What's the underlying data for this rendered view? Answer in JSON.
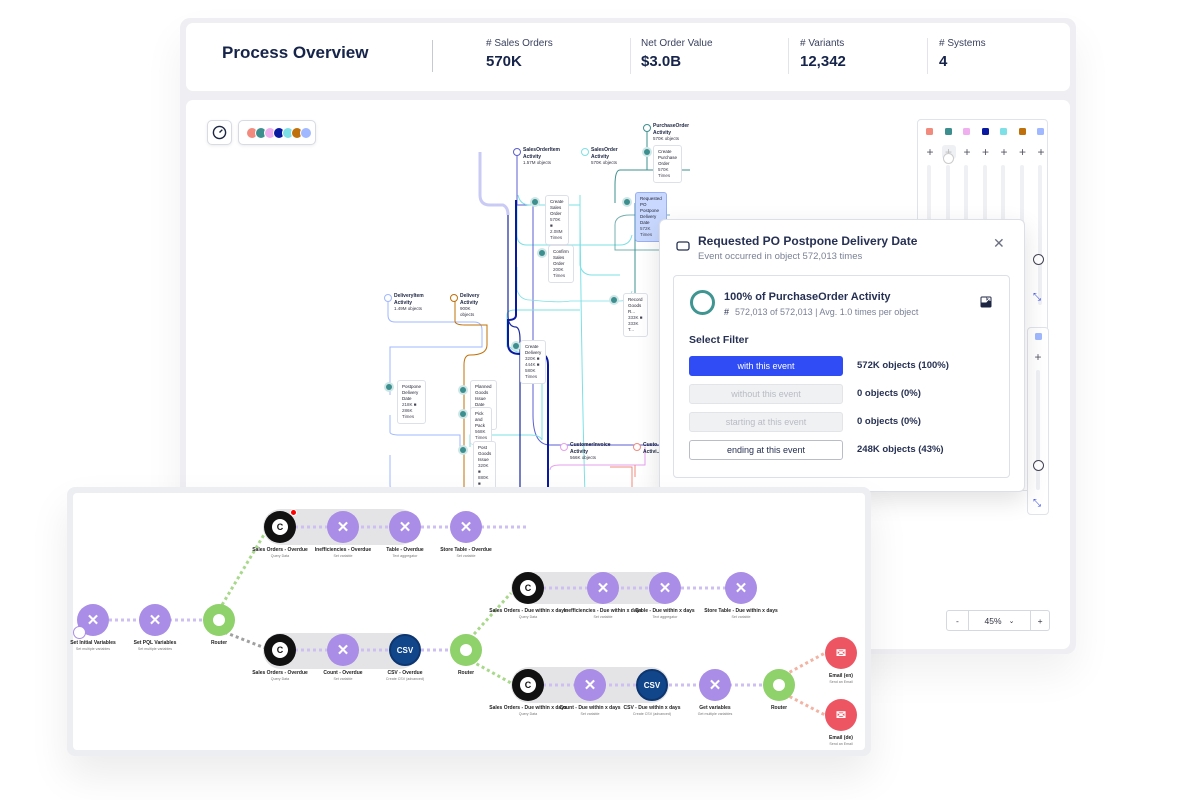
{
  "header": {
    "title": "Process Overview",
    "kpis": [
      {
        "label": "# Sales Orders",
        "value": "570K"
      },
      {
        "label": "Net Order Value",
        "value": "$3.0B"
      },
      {
        "label": "# Variants",
        "value": "12,342"
      },
      {
        "label": "# Systems",
        "value": "4"
      }
    ]
  },
  "toolbar": {
    "gauge_icon": "speedometer-icon",
    "object_colors": [
      "#f28b7d",
      "#3d8f8f",
      "#f0b0f0",
      "#0a1aa0",
      "#7de0e6",
      "#c0700a",
      "#a0b8ff"
    ]
  },
  "map": {
    "objects": [
      {
        "label": "SalesOrderItem Activity",
        "sub": "1.57M objects",
        "color": "#5b5fd0"
      },
      {
        "label": "SalesOrder Activity",
        "sub": "570K objects",
        "color": "#7de0e6"
      },
      {
        "label": "PurchaseOrder Activity",
        "sub": "570K objects",
        "color": "#3d8f8f"
      },
      {
        "label": "DeliveryItem Activity",
        "sub": "1.49M objects",
        "color": "#a0b8ff"
      },
      {
        "label": "Delivery Activity",
        "sub": "900K objects",
        "color": "#c0700a"
      },
      {
        "label": "CustomerInvoice Activity",
        "sub": "566K objects",
        "color": "#e6a0ee"
      },
      {
        "label": "Custo... Activi...",
        "sub": "",
        "color": "#f28b7d"
      }
    ],
    "events": [
      {
        "label": "Create Purchase Order",
        "sub": "570K Times"
      },
      {
        "label": "Create Sales Order",
        "sub": "570K  ■ 2.08M Times"
      },
      {
        "label": "Requested PO Postpone Delivery Date",
        "sub": "572K Times",
        "highlighted": true
      },
      {
        "label": "Confirm Sales Order",
        "sub": "200K Times"
      },
      {
        "label": "Record Goods R...",
        "sub": "333K  ■ 333K T..."
      },
      {
        "label": "Create Delivery",
        "sub": "320K  ■ 444K  ■ 580K Times"
      },
      {
        "label": "Postpone Delivery Date",
        "sub": "218K  ■ 286K Times"
      },
      {
        "label": "Planned Goods Issue Date Passed",
        "sub": "568K Times"
      },
      {
        "label": "Pick and Pack",
        "sub": "568K Times"
      },
      {
        "label": "Post Goods Issue",
        "sub": "320K  ■ 880K  ■ 568K Times"
      }
    ]
  },
  "side_panel": {
    "colors": [
      "#f28b7d",
      "#3d8f8f",
      "#f0b0f0",
      "#0a1aa0",
      "#7de0e6",
      "#c0700a",
      "#a0b8ff"
    ],
    "second_color": "#a0b8ff"
  },
  "popup": {
    "title": "Requested PO Postpone Delivery Date",
    "subtitle": "Event occurred in object 572,013 times",
    "card_title": "100% of PurchaseOrder Activity",
    "card_sub": "572,013 of 572,013 | Avg. 1.0 times per object",
    "coverage_percent": 100,
    "filter_heading": "Select Filter",
    "filters": [
      {
        "label": "with this event",
        "result": "572K objects (100%)",
        "state": "active"
      },
      {
        "label": "without this event",
        "result": "0 objects (0%)",
        "state": "disabled"
      },
      {
        "label": "starting at this event",
        "result": "0 objects (0%)",
        "state": "disabled"
      },
      {
        "label": "ending at this event",
        "result": "248K objects (43%)",
        "state": "default"
      }
    ]
  },
  "zoom": {
    "minus": "-",
    "value": "45%",
    "plus": "+"
  },
  "workflow": {
    "nodes": [
      {
        "type": "tool",
        "label": "Set Initial Variables",
        "sub": "Set multiple variables"
      },
      {
        "type": "tool",
        "label": "Set PQL Variables",
        "sub": "Set multiple variables"
      },
      {
        "type": "router",
        "label": "Router",
        "sub": ""
      },
      {
        "type": "celonis",
        "label": "Sales Orders - Overdue",
        "sub": "Query Data",
        "alert": true
      },
      {
        "type": "tool",
        "label": "Inefficiencies - Overdue",
        "sub": "Set variable"
      },
      {
        "type": "tool",
        "label": "Table - Overdue",
        "sub": "Text aggregator"
      },
      {
        "type": "tool",
        "label": "Store Table - Overdue",
        "sub": "Set variable"
      },
      {
        "type": "celonis",
        "label": "Sales Orders - Overdue",
        "sub": "Query Data"
      },
      {
        "type": "tool",
        "label": "Count - Overdue",
        "sub": "Set variable"
      },
      {
        "type": "csv",
        "label": "CSV - Overdue",
        "sub": "Create CSV (advanced)"
      },
      {
        "type": "router",
        "label": "Router",
        "sub": ""
      },
      {
        "type": "celonis",
        "label": "Sales Orders - Due within x days",
        "sub": "Query Data"
      },
      {
        "type": "tool",
        "label": "Inefficiencies - Due within x days",
        "sub": "Set variable"
      },
      {
        "type": "tool",
        "label": "Table - Due within x days",
        "sub": "Text aggregator"
      },
      {
        "type": "tool",
        "label": "Store Table - Due within x days",
        "sub": "Set variable"
      },
      {
        "type": "celonis",
        "label": "Sales Orders - Due within x days",
        "sub": "Query Data"
      },
      {
        "type": "tool",
        "label": "Count - Due within x days",
        "sub": "Set variable"
      },
      {
        "type": "csv",
        "label": "CSV - Due within x days",
        "sub": "Create CSV (advanced)"
      },
      {
        "type": "tool",
        "label": "Get variables",
        "sub": "Get multiple variables"
      },
      {
        "type": "router",
        "label": "Router",
        "sub": ""
      },
      {
        "type": "email",
        "label": "Email (en)",
        "sub": "Send an Email"
      },
      {
        "type": "email",
        "label": "Email (de)",
        "sub": "Send an Email"
      }
    ],
    "colors": {
      "tool": "#a98de6",
      "router": "#8fd16a",
      "celonis": "#111111",
      "csv": "#12468a",
      "email": "#ee5563"
    }
  }
}
